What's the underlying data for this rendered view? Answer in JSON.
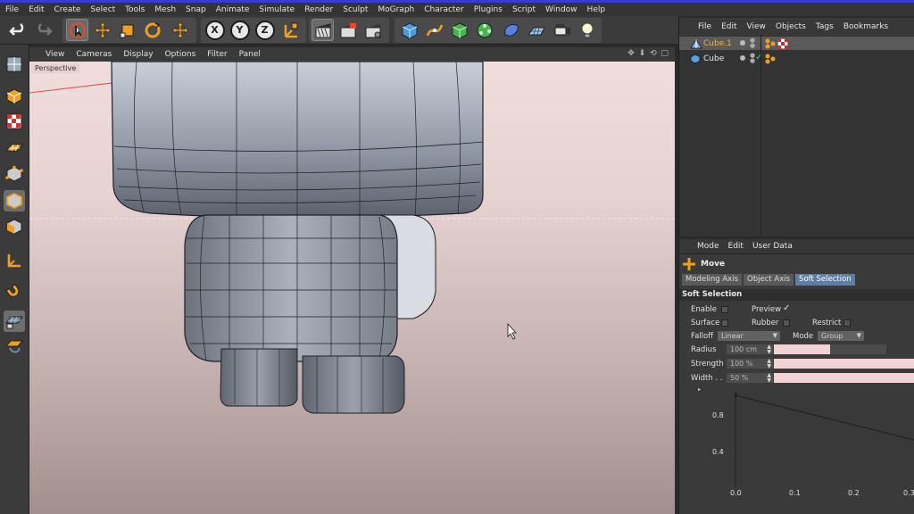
{
  "menubar": {
    "items": [
      "File",
      "Edit",
      "Create",
      "Select",
      "Tools",
      "Mesh",
      "Snap",
      "Animate",
      "Simulate",
      "Render",
      "Sculpt",
      "MoGraph",
      "Character",
      "Plugins",
      "Script",
      "Window",
      "Help"
    ]
  },
  "toolbar": {
    "axis_x": "X",
    "axis_y": "Y",
    "axis_z": "Z"
  },
  "viewport": {
    "menu": [
      "View",
      "Cameras",
      "Display",
      "Options",
      "Filter",
      "Panel"
    ],
    "nav_icons": "✥ ⬇ ⟲ ▢",
    "camera_label": "Perspective"
  },
  "object_manager": {
    "menu": [
      "File",
      "Edit",
      "View",
      "Objects",
      "Tags",
      "Bookmarks"
    ],
    "objects": [
      {
        "name": "Cube.1",
        "selected": true
      },
      {
        "name": "Cube",
        "selected": false
      }
    ]
  },
  "attribute_manager": {
    "menu": [
      "Mode",
      "Edit",
      "User Data"
    ],
    "tool_name": "Move",
    "tabs": [
      "Modeling Axis",
      "Object Axis",
      "Soft Selection"
    ],
    "active_tab": "Soft Selection",
    "section_title": "Soft Selection",
    "enable_label": "Enable",
    "preview_label": "Preview",
    "preview_mark": "✓",
    "surface_label": "Surface",
    "rubber_label": "Rubber",
    "restrict_label": "Restrict",
    "falloff_label": "Falloff",
    "falloff_value": "Linear",
    "mode_label": "Mode",
    "mode_value": "Group",
    "radius_label": "Radius",
    "radius_value": "100 cm",
    "radius_fill": 0.5,
    "strength_label": "Strength",
    "strength_value": "100 %",
    "strength_fill": 1.0,
    "width_label": "Width . .",
    "width_value": "50 %",
    "width_fill": 1.0,
    "graph": {
      "y_ticks": [
        "0.8",
        "0.4"
      ],
      "x_ticks": [
        "0.0",
        "0.1",
        "0.2",
        "0.3"
      ]
    }
  },
  "colors": {
    "accent_blue": "#5b7fa8",
    "viewport_top": "#f1dcdc",
    "slider_fill": "#f2d3d3",
    "top_strip": "#3a3adc"
  }
}
